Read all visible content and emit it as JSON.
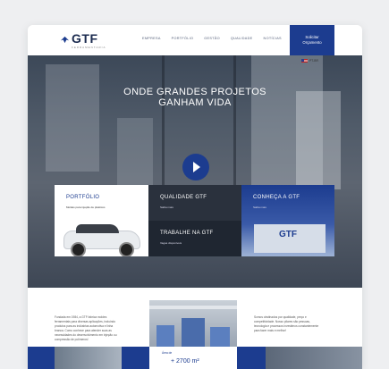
{
  "header": {
    "logo_text": "GTF",
    "logo_sub": "FERRAMENTARIA",
    "nav": [
      "EMPRESA",
      "PORTFÓLIO",
      "GESTÃO",
      "QUALIDADE",
      "NOTÍCIAS",
      "CONTATO"
    ],
    "cta_line1": "Solicitar",
    "cta_line2": "Orçamento",
    "language": "PT-BR"
  },
  "hero": {
    "title_line1": "ONDE GRANDES PROJETOS",
    "title_line2": "GANHAM VIDA"
  },
  "tiles": [
    {
      "title": "PORTFÓLIO",
      "subtitle": "Moldes para injeção de plásticos"
    },
    {
      "title": "QUALIDADE GTF",
      "subtitle": "Saiba mais"
    },
    {
      "title": "TRABALHE NA GTF",
      "subtitle": "Vagas disponíveis"
    },
    {
      "title": "CONHEÇA A GTF",
      "subtitle": "Saiba mais"
    }
  ],
  "building_sign": "GTF",
  "about": {
    "left_text": "Fundada em 1984, a GTF fabrica moldes ferramentais para diversas aplicações, incluindo produtos para as indústrias automotiva e linha branca. Como conhece para atender suas as necessidades do desenvolvimento em injeção ou compressão de polímeros!",
    "right_text": "Somos obstinados por qualidade, preço e competitividade. Nosso pilares são pessoas, tecnologia e processos investimos constantemente para fazer mais e melhor!"
  },
  "stats": {
    "label": "Área de",
    "area_value": "+ 2700 m²"
  },
  "colors": {
    "brand": "#1c3c8f",
    "dark_tile": "#2a313d"
  }
}
